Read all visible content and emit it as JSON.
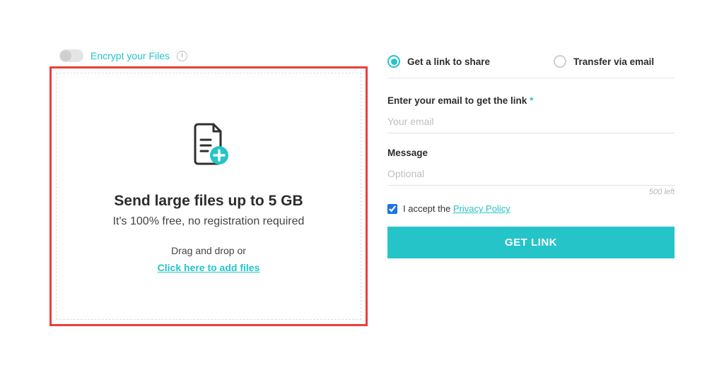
{
  "encrypt": {
    "label": "Encrypt your Files"
  },
  "dropzone": {
    "headline": "Send large files up to 5 GB",
    "subline": "It's 100% free, no registration required",
    "dnd_text": "Drag and drop or",
    "click_text": "Click here to add files"
  },
  "radio": {
    "link": "Get a link to share",
    "email": "Transfer via email"
  },
  "email_field": {
    "label": "Enter your email to get the link",
    "required_mark": "*",
    "placeholder": "Your email"
  },
  "message_field": {
    "label": "Message",
    "placeholder": "Optional",
    "counter": "500 left"
  },
  "accept": {
    "prefix": "I accept the ",
    "link_text": "Privacy Policy"
  },
  "submit": {
    "label": "GET LINK"
  }
}
